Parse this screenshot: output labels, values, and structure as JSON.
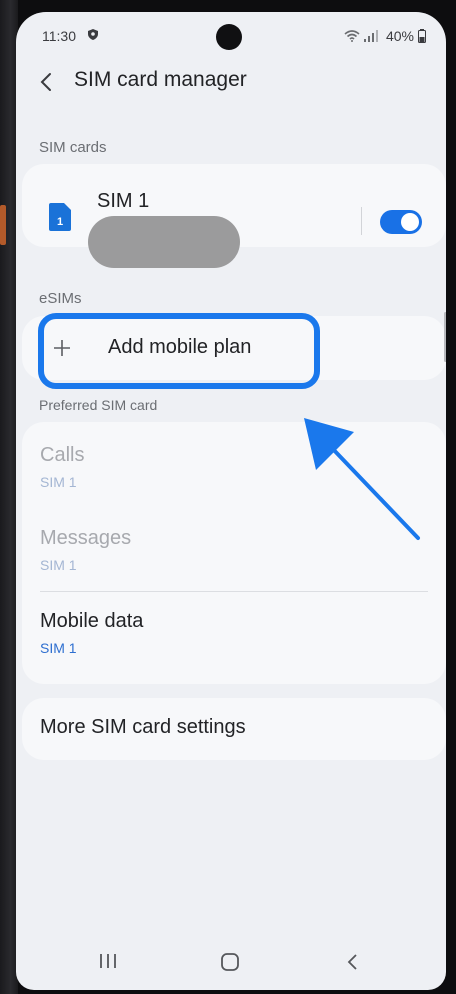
{
  "status_bar": {
    "time": "11:30",
    "battery": "40%",
    "icons": [
      "shield-icon",
      "wifi-icon",
      "signal-icon"
    ]
  },
  "header": {
    "title": "SIM card manager",
    "back_icon": "back-chevron-icon"
  },
  "sim_section": {
    "label": "SIM cards",
    "sim": {
      "icon_number": "1",
      "name": "SIM 1",
      "enabled": true
    }
  },
  "esim_section": {
    "label": "eSIMs",
    "add_label": "Add mobile plan"
  },
  "preferred_section": {
    "label": "Preferred SIM card",
    "rows": [
      {
        "title": "Calls",
        "value": "SIM 1",
        "enabled": false
      },
      {
        "title": "Messages",
        "value": "SIM 1",
        "enabled": false
      },
      {
        "title": "Mobile data",
        "value": "SIM 1",
        "enabled": true
      }
    ]
  },
  "more_settings": {
    "label": "More SIM card settings"
  },
  "nav_bar": {
    "icons": [
      "recents-icon",
      "home-icon",
      "back-icon"
    ]
  },
  "colors": {
    "accent": "#1a78ec",
    "toggle_on": "#1971e6",
    "background": "#eef0f4",
    "card": "#f7f8fa",
    "link_blue": "#2e6fd0"
  }
}
